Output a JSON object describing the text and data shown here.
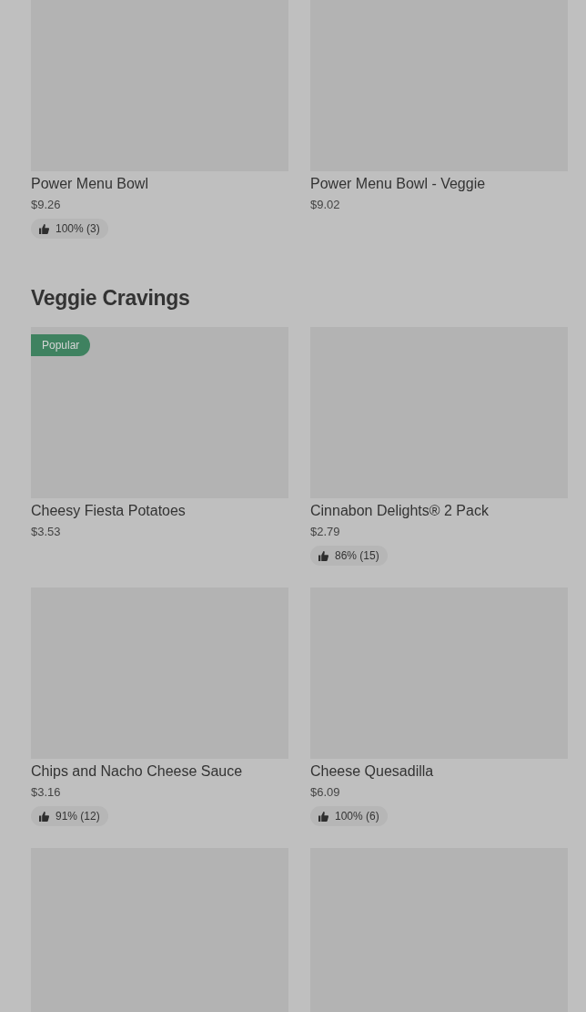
{
  "sections": [
    {
      "items": [
        {
          "kind": "full",
          "name": "Power Menu Bowl",
          "price": "$9.26",
          "rating": "100% (3)"
        },
        {
          "kind": "full",
          "name": "Power Menu Bowl - Veggie",
          "price": "$9.02"
        }
      ]
    },
    {
      "title": "Veggie Cravings",
      "items": [
        {
          "kind": "full",
          "badge": "Popular",
          "name": "Cheesy Fiesta Potatoes",
          "price": "$3.53"
        },
        {
          "kind": "full",
          "name": "Cinnabon Delights® 2 Pack",
          "price": "$2.79",
          "rating": "86% (15)"
        },
        {
          "kind": "full",
          "name": "Chips and Nacho Cheese Sauce",
          "price": "$3.16",
          "rating": "91% (12)"
        },
        {
          "kind": "full",
          "name": "Cheese Quesadilla",
          "price": "$6.09",
          "rating": "100% (6)"
        },
        {
          "kind": "image_only"
        },
        {
          "kind": "image_only"
        }
      ]
    }
  ]
}
